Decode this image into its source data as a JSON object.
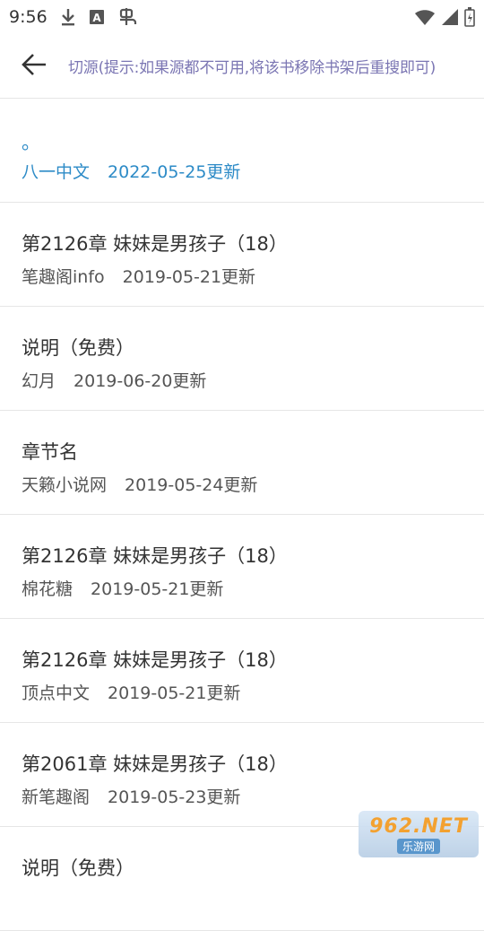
{
  "status_bar": {
    "time": "9:56",
    "icons": [
      "download-icon",
      "font-icon",
      "bug-icon",
      "wifi-icon",
      "signal-icon",
      "battery-icon"
    ]
  },
  "app_bar": {
    "back_icon": "arrow-left-icon",
    "title": "切源(提示:如果源都不可用,将该书移除书架后重搜即可)"
  },
  "sources": [
    {
      "chapter": "。",
      "site": "八一中文",
      "date": "2022-05-25更新",
      "selected": true
    },
    {
      "chapter": "第2126章 妹妹是男孩子（18）",
      "site": "笔趣阁info",
      "date": "2019-05-21更新"
    },
    {
      "chapter": "说明（免费）",
      "site": "幻月",
      "date": "2019-06-20更新"
    },
    {
      "chapter": "章节名",
      "site": "天籁小说网",
      "date": "2019-05-24更新"
    },
    {
      "chapter": "第2126章 妹妹是男孩子（18）",
      "site": "棉花糖",
      "date": "2019-05-21更新"
    },
    {
      "chapter": "第2126章 妹妹是男孩子（18）",
      "site": "顶点中文",
      "date": "2019-05-21更新"
    },
    {
      "chapter": "第2061章 妹妹是男孩子（18）",
      "site": "新笔趣阁",
      "date": "2019-05-23更新"
    },
    {
      "chapter": "说明（免费）",
      "site": "",
      "date": ""
    }
  ],
  "watermark": {
    "logo": "962.NET",
    "sub": "乐游网"
  },
  "colors": {
    "accent": "#2d8bc7",
    "title": "#7b76b3",
    "divider": "#e6e6e6"
  }
}
